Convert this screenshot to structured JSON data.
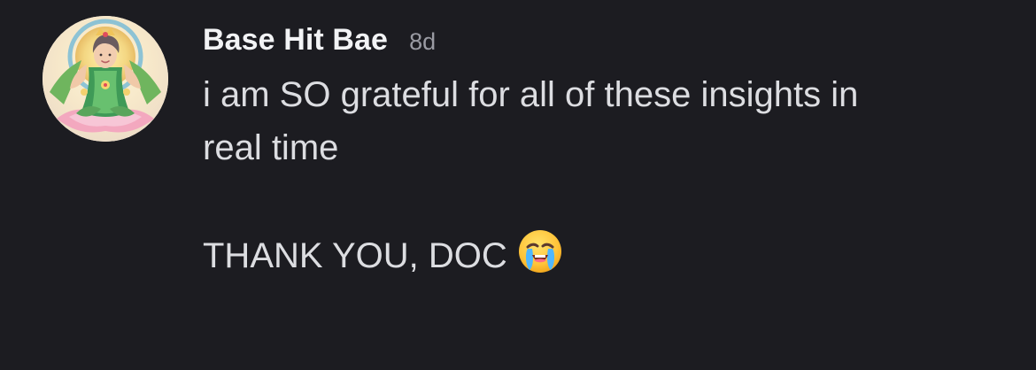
{
  "message": {
    "author": "Base Hit Bae",
    "timestamp": "8d",
    "lines": [
      "i am SO grateful for all of these insights in",
      "real time",
      "THANK YOU, DOC"
    ],
    "emoji": "loudly-crying-face"
  },
  "colors": {
    "background": "#1c1c21",
    "username": "#f2f3f5",
    "timestamp": "#9a9ba3",
    "body": "#dcdde1"
  }
}
